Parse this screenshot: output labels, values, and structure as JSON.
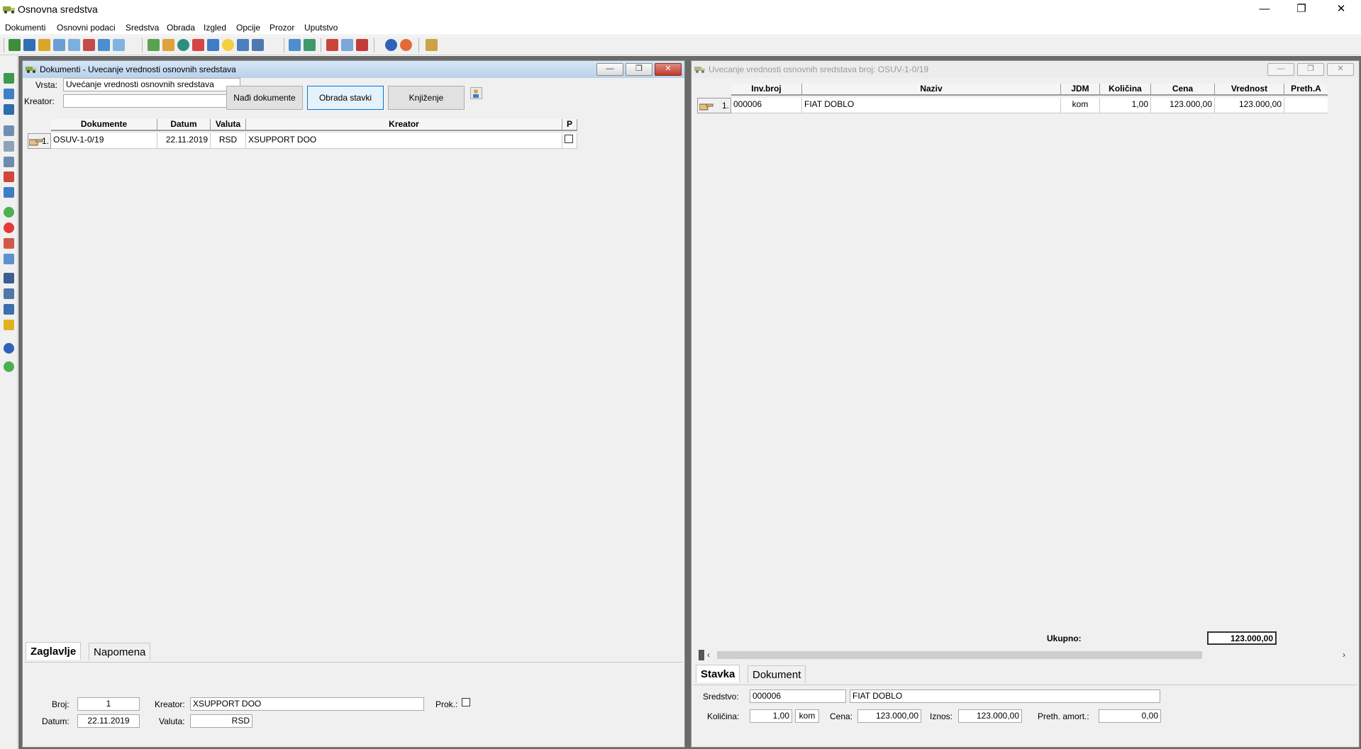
{
  "app": {
    "title": "Osnovna sredstva"
  },
  "window_controls": {
    "minimize": "—",
    "restore": "❐",
    "close": "✕"
  },
  "menu": [
    "Dokumenti",
    "Osnovni podaci",
    "Sredstva",
    "Obrada",
    "Izgled",
    "Opcije",
    "Prozor",
    "Uputstvo"
  ],
  "doc_window": {
    "title": "Dokumenti - Uvecanje vrednosti osnovnih sredstava",
    "vrsta_label": "Vrsta:",
    "vrsta_value": "Uvećanje vrednosti osnovnih sredstava",
    "kreator_label": "Kreator:",
    "kreator_value": "",
    "buttons": {
      "find": "Nađi dokumente",
      "process": "Obrada stavki",
      "post": "Knjiženje"
    },
    "columns": [
      "Dokumente",
      "Datum",
      "Valuta",
      "Kreator",
      "P"
    ],
    "rows": [
      {
        "idx": "1.",
        "dokument": "OSUV-1-0/19",
        "datum": "22.11.2019",
        "valuta": "RSD",
        "kreator": "XSUPPORT DOO",
        "p": false
      }
    ],
    "tabs": {
      "header": "Zaglavlje",
      "note": "Napomena"
    },
    "form": {
      "broj_label": "Broj:",
      "broj": "1",
      "datum_label": "Datum:",
      "datum": "22.11.2019",
      "kreator_label": "Kreator:",
      "kreator": "XSUPPORT DOO",
      "valuta_label": "Valuta:",
      "valuta": "RSD",
      "prok_label": "Prok.:"
    }
  },
  "items_window": {
    "title": "Uvecanje vrednosti osnovnih sredstava broj: OSUV-1-0/19",
    "columns": [
      "Inv.broj",
      "Naziv",
      "JDM",
      "Količina",
      "Cena",
      "Vrednost",
      "Preth.A"
    ],
    "rows": [
      {
        "idx": "1.",
        "inv": "000006",
        "naziv": "FIAT DOBLO",
        "jdm": "kom",
        "kolicina": "1,00",
        "cena": "123.000,00",
        "vrednost": "123.000,00",
        "preth": ""
      }
    ],
    "total_label": "Ukupno:",
    "total": "123.000,00",
    "tabs": {
      "item": "Stavka",
      "document": "Dokument"
    },
    "form": {
      "sredstvo_label": "Sredstvo:",
      "sredstvo_code": "000006",
      "sredstvo_name": "FIAT DOBLO",
      "kolicina_label": "Količina:",
      "kolicina": "1,00",
      "jdm": "kom",
      "cena_label": "Cena:",
      "cena": "123.000,00",
      "iznos_label": "Iznos:",
      "iznos": "123.000,00",
      "preth_label": "Preth. amort.:",
      "preth": "0,00"
    }
  }
}
